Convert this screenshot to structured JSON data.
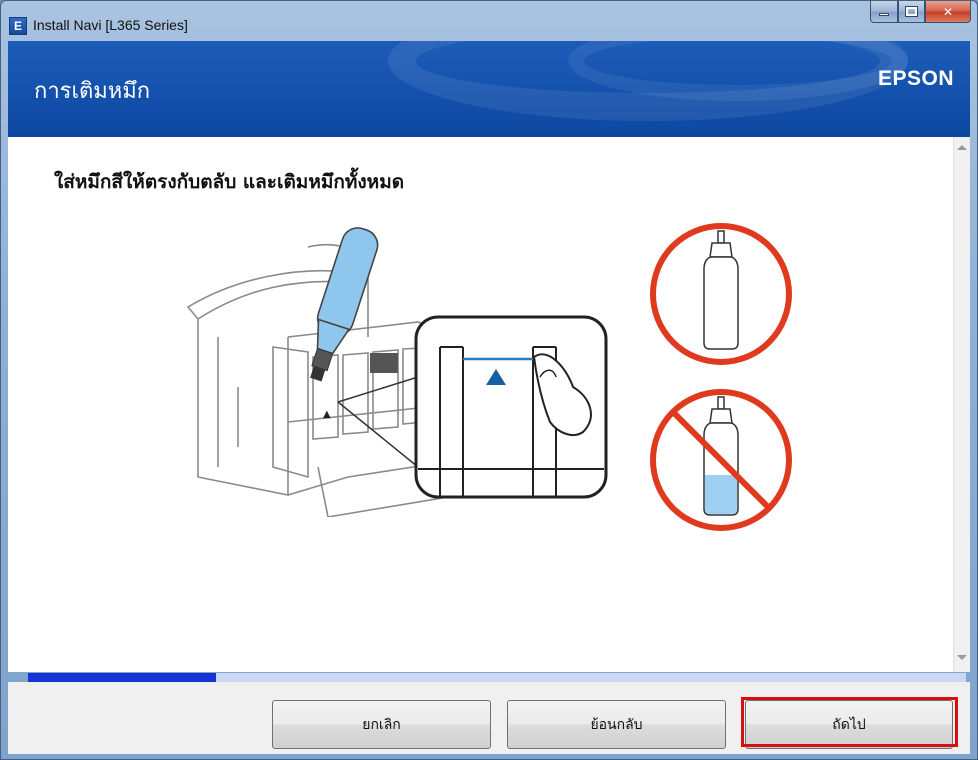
{
  "window": {
    "title": "Install Navi [L365 Series]",
    "app_icon_letter": "E"
  },
  "header": {
    "title": "การเติมหมึก",
    "brand": "EPSON"
  },
  "main": {
    "instruction": "ใส่หมึกสีให้ตรงกับตลับ และเติมหมึกทั้งหมด"
  },
  "progress": {
    "value": 0.2
  },
  "buttons": {
    "cancel": "ยกเลิก",
    "back": "ย้อนกลับ",
    "next": "ถัดไป"
  },
  "colors": {
    "header_blue": "#1452ad",
    "ink_blue": "#8ec6ee",
    "progress_fill": "#1434d6",
    "prohibit_red": "#e03a1e",
    "highlight_red": "#d80f0f"
  }
}
